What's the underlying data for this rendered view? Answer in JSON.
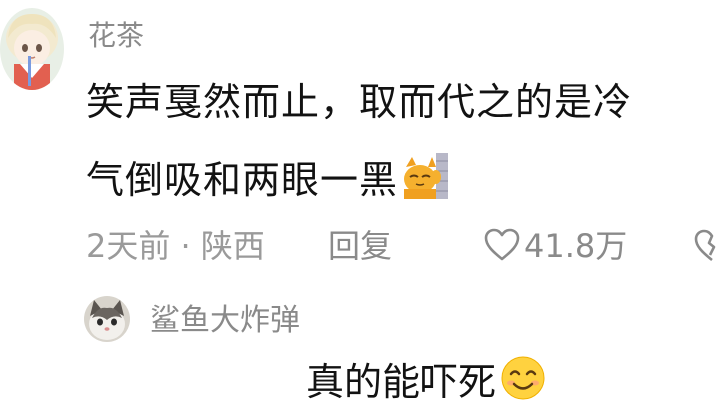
{
  "comment": {
    "username": "花茶",
    "text_line1": "笑声戛然而止，取而代之的是冷",
    "text_line2": "气倒吸和两眼一黑",
    "emoji": "cat-facepalm-emoji",
    "time_location": "2天前 · 陕西",
    "reply_label": "回复",
    "like_count": "41.8万"
  },
  "reply": {
    "username": "鲨鱼大炸弹",
    "text": "真的能吓死",
    "emoji": "smiling-face-emoji"
  },
  "colors": {
    "username_gray": "#8a8a8a",
    "text_black": "#121212",
    "meta_gray": "#9a9a9a",
    "background": "#ffffff"
  }
}
